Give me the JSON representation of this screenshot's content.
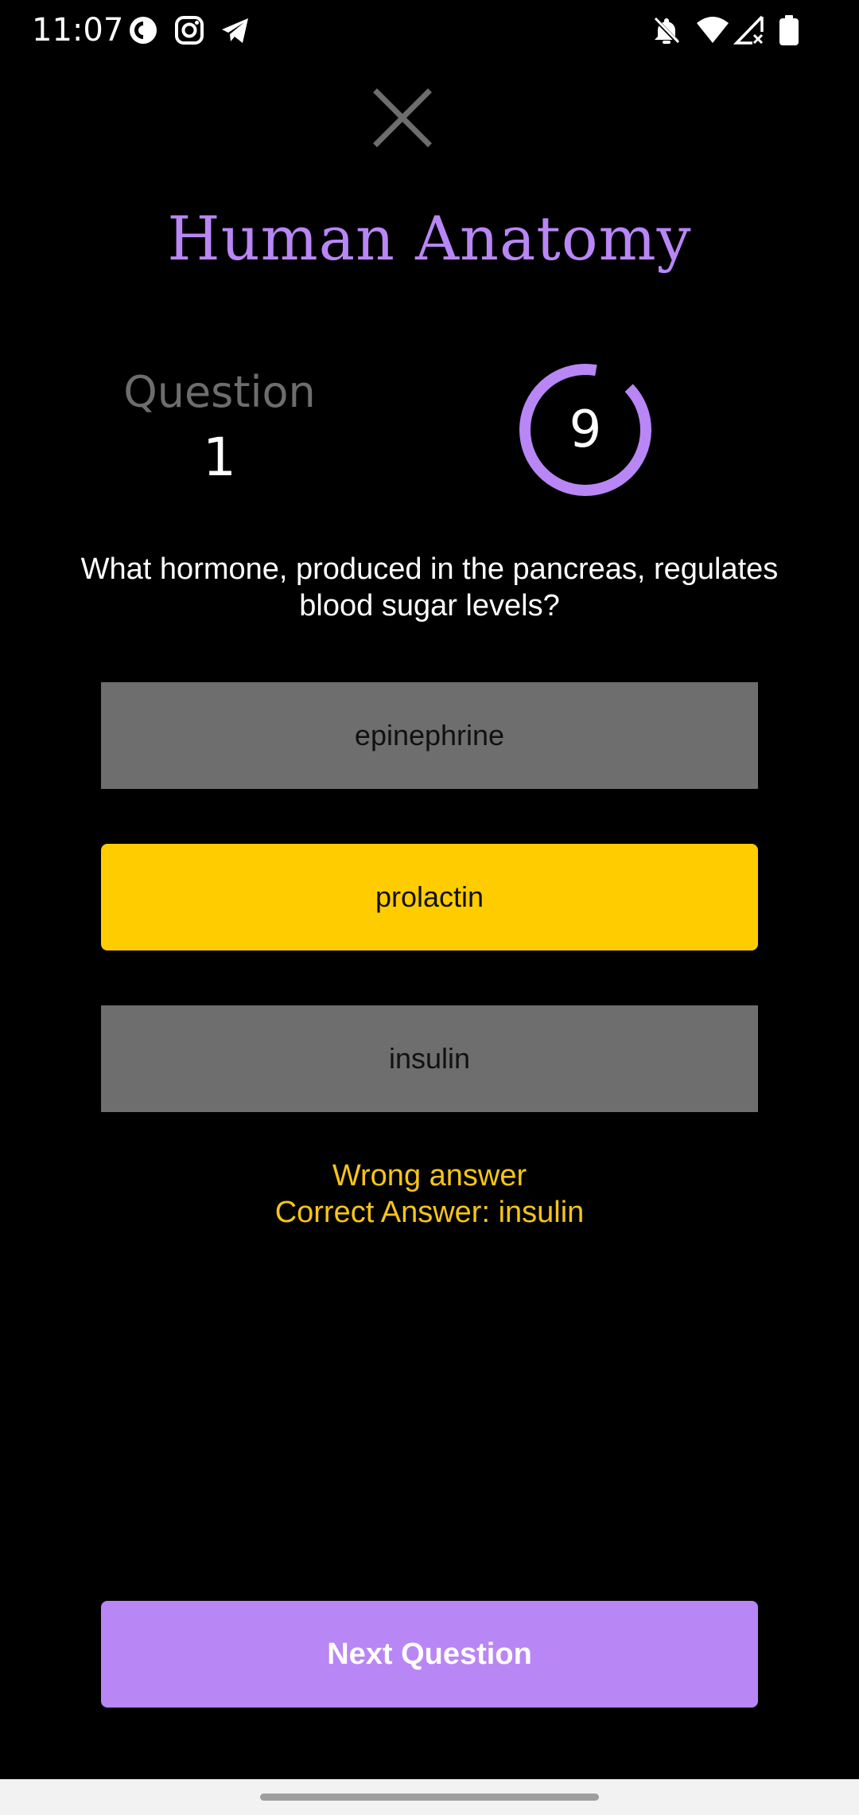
{
  "status_bar": {
    "time": "11:07",
    "left_icons": [
      "pocket-casts-icon",
      "instagram-icon",
      "telegram-icon"
    ],
    "right_icons": [
      "notifications-off-icon",
      "wifi-icon",
      "no-signal-icon",
      "battery-icon"
    ]
  },
  "quiz": {
    "title": "Human Anatomy",
    "question_label": "Question",
    "question_number": "1",
    "timer_value": "9",
    "timer_progress": 0.9,
    "question_text": "What hormone, produced in the pancreas, regulates blood sugar levels?",
    "answers": [
      {
        "label": "epinephrine",
        "state": "neutral"
      },
      {
        "label": "prolactin",
        "state": "selected-wrong"
      },
      {
        "label": "insulin",
        "state": "neutral"
      }
    ],
    "feedback_line1": "Wrong answer",
    "feedback_line2": "Correct Answer: insulin",
    "next_button_label": "Next Question"
  },
  "colors": {
    "background": "#000000",
    "accent": "#b986f5",
    "answer_neutral": "#6e6e6e",
    "answer_wrong": "#ffcc00",
    "feedback": "#f5c518",
    "close_icon": "#6d6d6d"
  }
}
